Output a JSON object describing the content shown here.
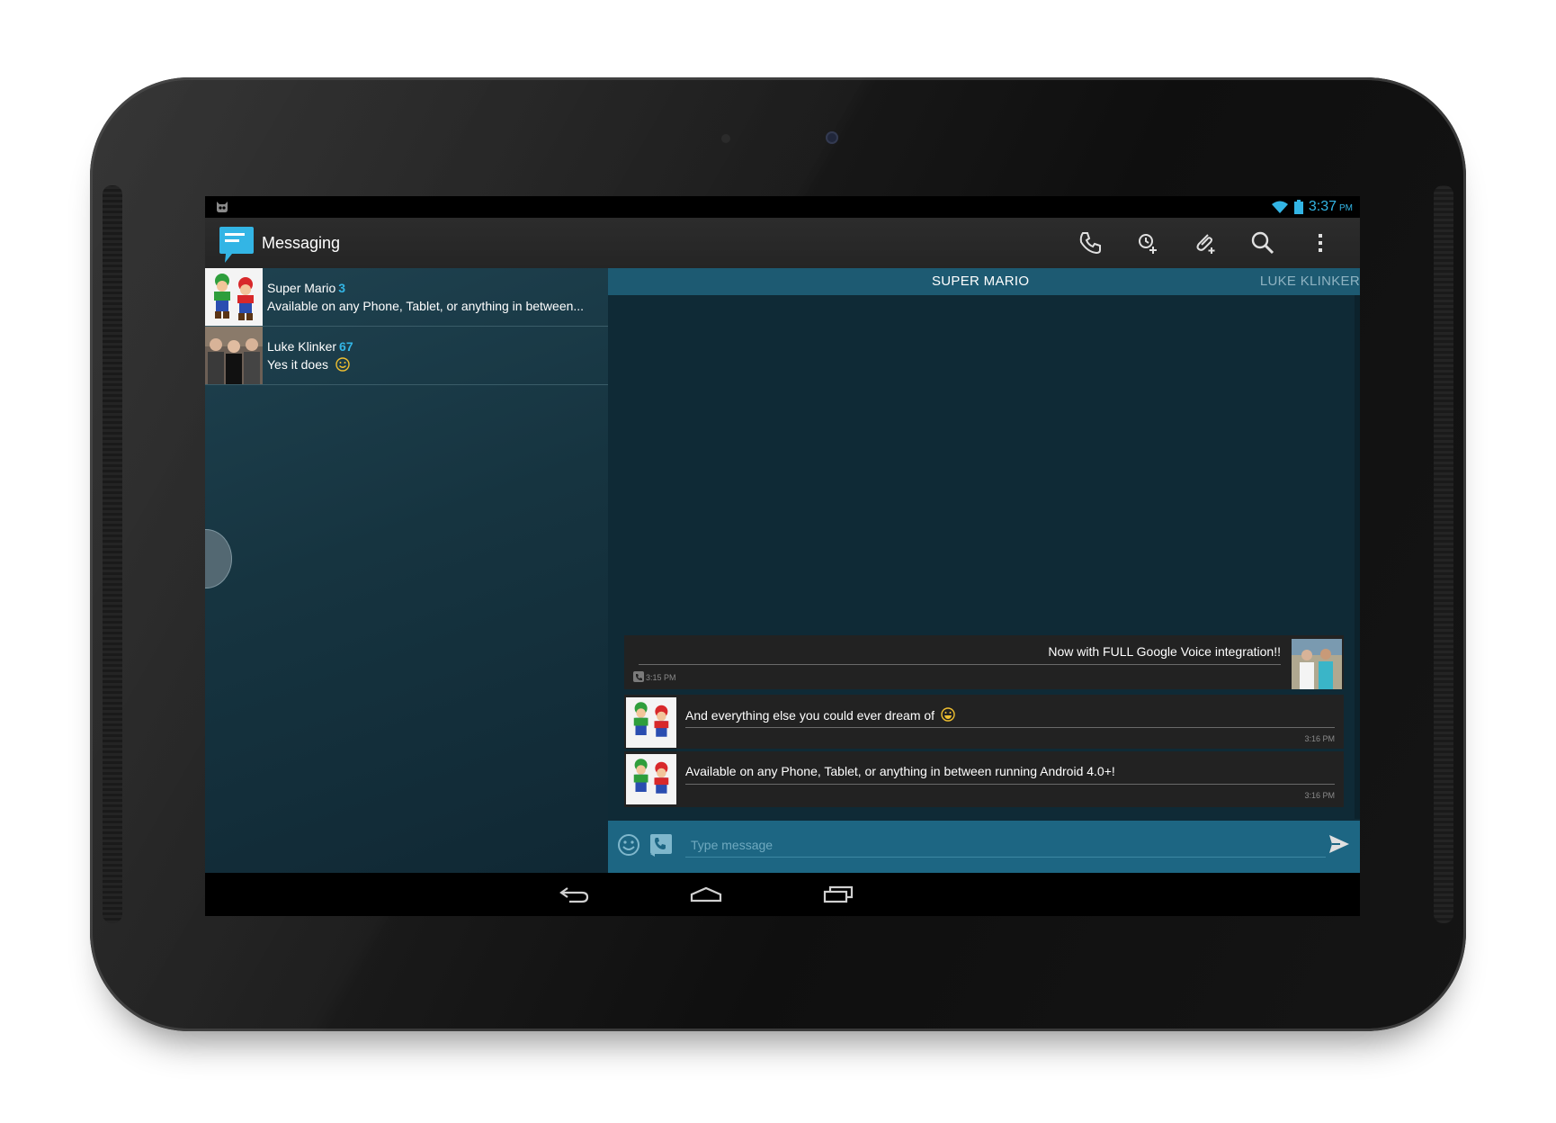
{
  "status_bar": {
    "time": "3:37",
    "ampm": "PM"
  },
  "action_bar": {
    "title": "Messaging",
    "icons": [
      "call-icon",
      "schedule-alarm-icon",
      "attach-icon",
      "search-icon",
      "overflow-menu-icon"
    ]
  },
  "conversations": [
    {
      "name": "Super Mario",
      "count": "3",
      "snippet": "Available on any Phone, Tablet, or anything in between...",
      "avatar": "mario-luigi-avatar"
    },
    {
      "name": "Luke Klinker",
      "count": "67",
      "snippet": "Yes it does",
      "avatar": "group-photo-avatar",
      "emoji": "smiley-icon"
    }
  ],
  "tabs": {
    "active": "SUPER MARIO",
    "next": "LUKE KLINKER"
  },
  "messages": [
    {
      "direction": "outgoing",
      "text": "Now with FULL Google Voice integration!!",
      "time": "3:15 PM",
      "via": "google-voice-icon"
    },
    {
      "direction": "incoming",
      "text": "And everything else you could ever dream of",
      "time": "3:16 PM",
      "emoji": "grin-emoji"
    },
    {
      "direction": "incoming",
      "text": "Available on any Phone, Tablet, or anything in between running Android 4.0+!",
      "time": "3:16 PM"
    }
  ],
  "composer": {
    "placeholder": "Type message"
  },
  "colors": {
    "accent": "#33b5e5",
    "tab_strip": "#1d5a72",
    "composer": "#1d6683",
    "bubble": "#222222"
  }
}
